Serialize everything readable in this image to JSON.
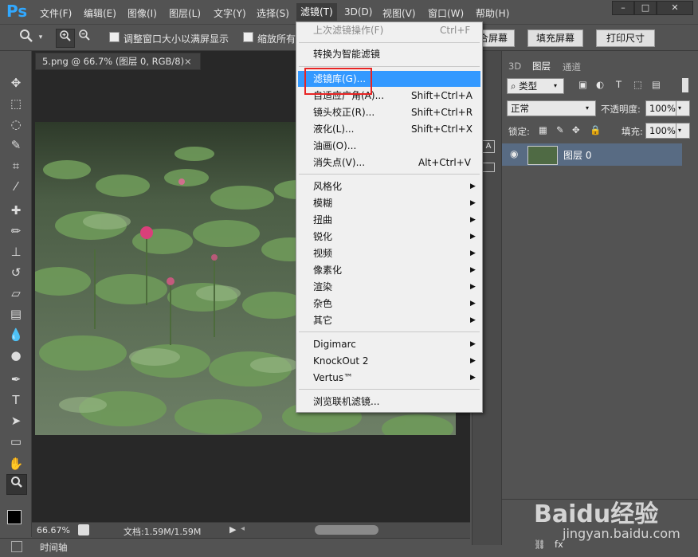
{
  "app": {
    "logo": "Ps"
  },
  "menubar": {
    "items": [
      "文件(F)",
      "编辑(E)",
      "图像(I)",
      "图层(L)",
      "文字(Y)",
      "选择(S)",
      "滤镜(T)",
      "3D(D)",
      "视图(V)",
      "窗口(W)",
      "帮助(H)"
    ],
    "active_index": 6
  },
  "window_controls": {
    "minimize": "–",
    "maximize": "□",
    "close": "✕"
  },
  "options": {
    "resize_label": "调整窗口大小以满屏显示",
    "zoom_all_label": "缩放所有",
    "fit_screen": "合屏幕",
    "fill_screen": "填充屏幕",
    "print_size": "打印尺寸"
  },
  "document": {
    "tab_title": "5.png @ 66.7% (图层 0, RGB/8)",
    "tab_close": "×",
    "zoom": "66.67%",
    "doc_info": "文档:1.59M/1.59M",
    "timeline": "时间轴"
  },
  "filter_menu": {
    "items": [
      {
        "label": "上次滤镜操作(F)",
        "shortcut": "Ctrl+F",
        "disabled": true
      },
      {
        "label": "转换为智能滤镜"
      },
      {
        "label": "滤镜库(G)...",
        "highlighted": true
      },
      {
        "label": "自适应广角(A)...",
        "shortcut": "Shift+Ctrl+A"
      },
      {
        "label": "镜头校正(R)...",
        "shortcut": "Shift+Ctrl+R"
      },
      {
        "label": "液化(L)...",
        "shortcut": "Shift+Ctrl+X"
      },
      {
        "label": "油画(O)..."
      },
      {
        "label": "消失点(V)...",
        "shortcut": "Alt+Ctrl+V"
      },
      {
        "label": "风格化",
        "submenu": true
      },
      {
        "label": "模糊",
        "submenu": true
      },
      {
        "label": "扭曲",
        "submenu": true
      },
      {
        "label": "锐化",
        "submenu": true
      },
      {
        "label": "视频",
        "submenu": true
      },
      {
        "label": "像素化",
        "submenu": true
      },
      {
        "label": "渲染",
        "submenu": true
      },
      {
        "label": "杂色",
        "submenu": true
      },
      {
        "label": "其它",
        "submenu": true
      },
      {
        "label": "Digimarc",
        "submenu": true
      },
      {
        "label": "KnockOut 2",
        "submenu": true
      },
      {
        "label": "Vertus™",
        "submenu": true
      },
      {
        "label": "浏览联机滤镜..."
      }
    ]
  },
  "layers_panel": {
    "tabs": [
      "3D",
      "图层",
      "通道"
    ],
    "active_tab": 1,
    "filter_kind": "类型",
    "blend_mode": "正常",
    "opacity_label": "不透明度:",
    "opacity_value": "100%",
    "lock_label": "锁定:",
    "fill_label": "填充:",
    "fill_value": "100%",
    "layer_name": "图层 0"
  },
  "watermark": {
    "brand": "Baidu经验",
    "url": "jingyan.baidu.com"
  },
  "icons": [
    "zoom-tool-icon",
    "move-icon",
    "marquee-icon",
    "lasso-icon",
    "quick-select-icon",
    "crop-icon",
    "eyedropper-icon",
    "heal-icon",
    "brush-icon",
    "stamp-icon",
    "history-brush-icon",
    "eraser-icon",
    "gradient-icon",
    "blur-icon",
    "dodge-icon",
    "pen-icon",
    "type-icon",
    "path-select-icon",
    "shape-icon",
    "hand-icon",
    "eye-icon"
  ],
  "colors": {
    "menu_highlight": "#3399ff",
    "annotation": "#e82424",
    "ps_blue": "#31a8ff"
  }
}
